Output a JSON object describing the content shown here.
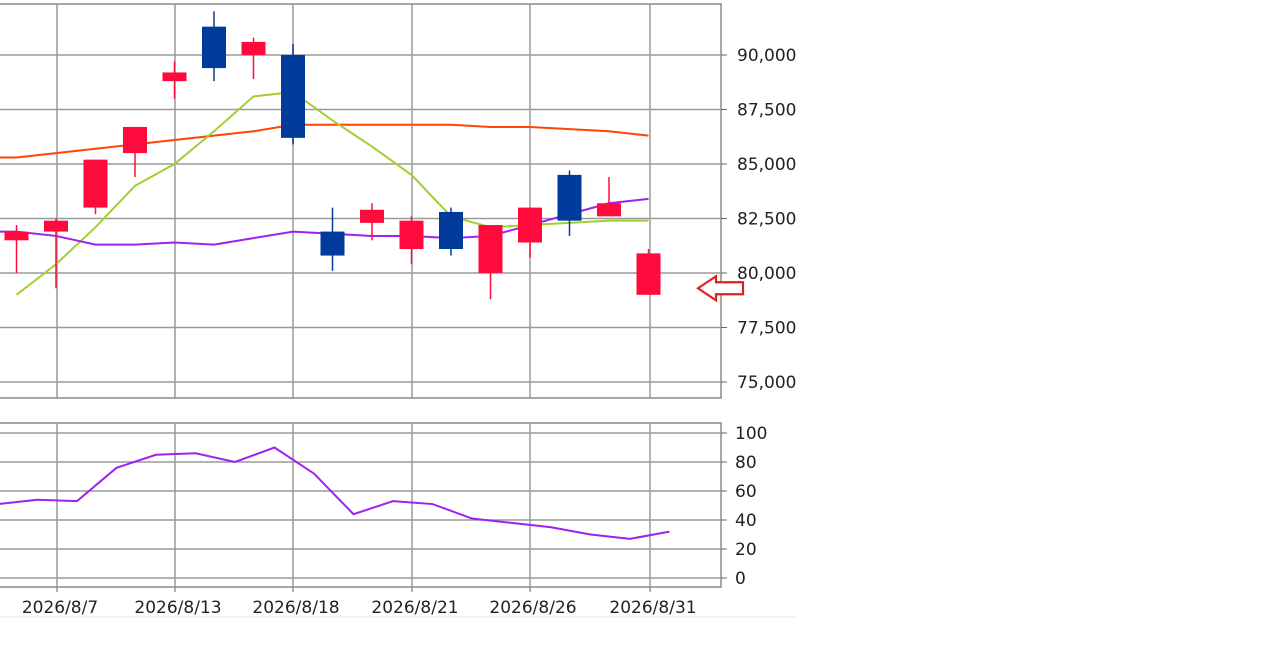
{
  "chart_data": [
    {
      "type": "candlestick",
      "title": "",
      "xlabel": "",
      "ylabel": "",
      "ylim": [
        73500,
        92000
      ],
      "y_ticks": [
        75000,
        77500,
        80000,
        82500,
        85000,
        87500,
        90000
      ],
      "y_tick_labels": [
        "75,000",
        "77,500",
        "80,000",
        "82,500",
        "85,000",
        "87,500",
        "90,000"
      ],
      "x_tick_labels": [
        "2026/8/7",
        "2026/8/13",
        "2026/8/18",
        "2026/8/21",
        "2026/8/26",
        "2026/8/31"
      ],
      "grid": true,
      "candles": [
        {
          "open": 81500,
          "close": 81900,
          "high": 82200,
          "low": 80000
        },
        {
          "open": 81900,
          "close": 82400,
          "high": 82500,
          "low": 79300
        },
        {
          "open": 83000,
          "close": 85200,
          "high": 85200,
          "low": 82700
        },
        {
          "open": 85500,
          "close": 86700,
          "high": 86700,
          "low": 84400
        },
        {
          "open": 88800,
          "close": 89200,
          "high": 89700,
          "low": 88000
        },
        {
          "open": 91300,
          "close": 89400,
          "high": 92000,
          "low": 88800
        },
        {
          "open": 90000,
          "close": 90600,
          "high": 90800,
          "low": 88900
        },
        {
          "open": 90000,
          "close": 86200,
          "high": 90500,
          "low": 85900
        },
        {
          "open": 81900,
          "close": 80800,
          "high": 83000,
          "low": 80100
        },
        {
          "open": 82300,
          "close": 82900,
          "high": 83200,
          "low": 81500
        },
        {
          "open": 81100,
          "close": 82400,
          "high": 82600,
          "low": 80400
        },
        {
          "open": 82800,
          "close": 81100,
          "high": 83000,
          "low": 80800
        },
        {
          "open": 80000,
          "close": 82200,
          "high": 82200,
          "low": 78800
        },
        {
          "open": 81400,
          "close": 83000,
          "high": 83000,
          "low": 80700
        },
        {
          "open": 84500,
          "close": 82400,
          "high": 84700,
          "low": 81700
        },
        {
          "open": 82600,
          "close": 83200,
          "high": 84400,
          "low": 82600
        },
        {
          "open": 79000,
          "close": 80900,
          "high": 81100,
          "low": 79000
        }
      ],
      "series": [
        {
          "color": "#ff4500",
          "values": [
            85300,
            85500,
            85700,
            85900,
            86100,
            86300,
            86500,
            86800,
            86800,
            86800,
            86800,
            86800,
            86700,
            86700,
            86600,
            86500,
            86300
          ]
        },
        {
          "color": "#a0d030",
          "values": [
            79000,
            80400,
            82100,
            84000,
            85000,
            86500,
            88100,
            88300,
            87000,
            85800,
            84500,
            82600,
            82100,
            82200,
            82300,
            82400,
            82400
          ]
        },
        {
          "color": "#a020f0",
          "values": [
            81900,
            81700,
            81300,
            81300,
            81400,
            81300,
            81600,
            81900,
            81800,
            81700,
            81700,
            81600,
            81700,
            82200,
            82700,
            83200,
            83400
          ]
        }
      ],
      "marker": {
        "type": "arrow",
        "color": "#e02020",
        "value": 79300
      }
    },
    {
      "type": "line",
      "title": "",
      "ylim": [
        0,
        100
      ],
      "y_ticks": [
        0,
        20,
        40,
        60,
        80,
        100
      ],
      "y_tick_labels": [
        "0",
        "20",
        "40",
        "60",
        "80",
        "100"
      ],
      "grid": true,
      "series": [
        {
          "color": "#a020f0",
          "values": [
            51,
            54,
            53,
            76,
            85,
            86,
            80,
            90,
            72,
            44,
            53,
            51,
            41,
            38,
            35,
            30,
            27,
            32
          ]
        }
      ]
    }
  ]
}
